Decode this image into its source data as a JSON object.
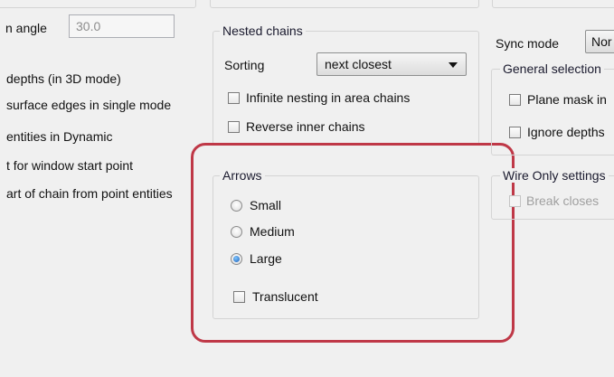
{
  "left_panel": {
    "angle_label": "n angle",
    "angle_value": "30.0",
    "options": [
      "depths (in 3D mode)",
      "surface edges in single mode",
      "entities in Dynamic",
      "t for window start point",
      "art of chain from point entities"
    ]
  },
  "nested_chains": {
    "legend": "Nested chains",
    "sorting_label": "Sorting",
    "sorting_value": "next closest",
    "infinite_label": "Infinite nesting in area chains",
    "reverse_label": "Reverse inner chains"
  },
  "arrows": {
    "legend": "Arrows",
    "small": "Small",
    "medium": "Medium",
    "large": "Large",
    "selected": "Large",
    "translucent_label": "Translucent"
  },
  "right_panel": {
    "sync_label": "Sync mode",
    "sync_value": "Nor",
    "general_legend": "General selection",
    "plane_mask_label": "Plane mask in",
    "ignore_depths_label": "Ignore depths",
    "wire_legend": "Wire Only settings",
    "break_label": "Break closes"
  },
  "colors": {
    "callout_border": "#bf3847",
    "panel_background": "#f0f0f0",
    "group_border": "#d4d4d4"
  }
}
